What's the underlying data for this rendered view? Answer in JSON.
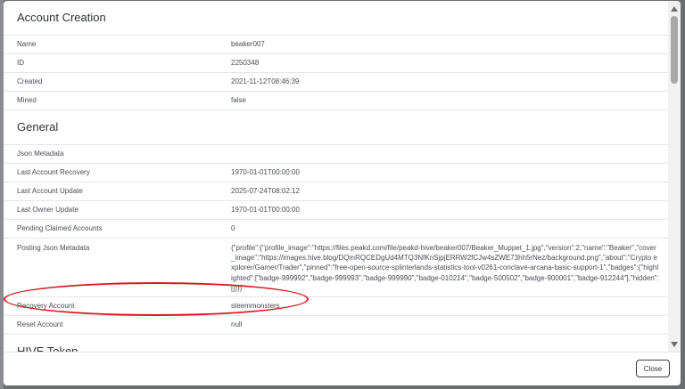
{
  "backdrop": {
    "text": ""
  },
  "sections": [
    {
      "title": "Account Creation",
      "rows": [
        {
          "key": "Name",
          "value": "beaker007"
        },
        {
          "key": "ID",
          "value": "2250348"
        },
        {
          "key": "Created",
          "value": "2021-11-12T08:46:39"
        },
        {
          "key": "Mined",
          "value": "false"
        }
      ]
    },
    {
      "title": "General",
      "rows": [
        {
          "key": "Json Metadata",
          "value": ""
        },
        {
          "key": "Last Account Recovery",
          "value": "1970-01-01T00:00:00"
        },
        {
          "key": "Last Account Update",
          "value": "2025-07-24T08:02:12"
        },
        {
          "key": "Last Owner Update",
          "value": "1970-01-01T00:00:00"
        },
        {
          "key": "Pending Claimed Accounts",
          "value": "0"
        },
        {
          "key": "Posting Json Metadata",
          "value": "{\"profile\":{\"profile_image\":\"https://files.peakd.com/file/peakd-hive/beaker007/Beaker_Muppet_1.jpg\",\"version\":2,\"name\":\"Beaker\",\"cover_image\":\"https://images.hive.blog/DQmRQCEDgUd4MTQ3NfKnSjpjERRW2fCJw4sZWE73hh5rNez/background.png\",\"about\":\"Crypto explorer/Gamer/Trader\",\"pinned\":\"free-open-source-splinterlands-statistics-tool-v0261-conclave-arcana-basic-support-1\",\"badges\":{\"highlighted\":[\"badge-999992\",\"badge-999993\",\"badge-999990\",\"badge-010214\",\"badge-500502\",\"badge-900001\",\"badge-912244\"],\"hidden\":[]}}}"
        },
        {
          "key": "Recovery Account",
          "value": "steemmonsters"
        },
        {
          "key": "Reset Account",
          "value": "null"
        }
      ]
    },
    {
      "title": "HIVE Token",
      "rows": []
    }
  ],
  "footer": {
    "close_label": "Close"
  }
}
